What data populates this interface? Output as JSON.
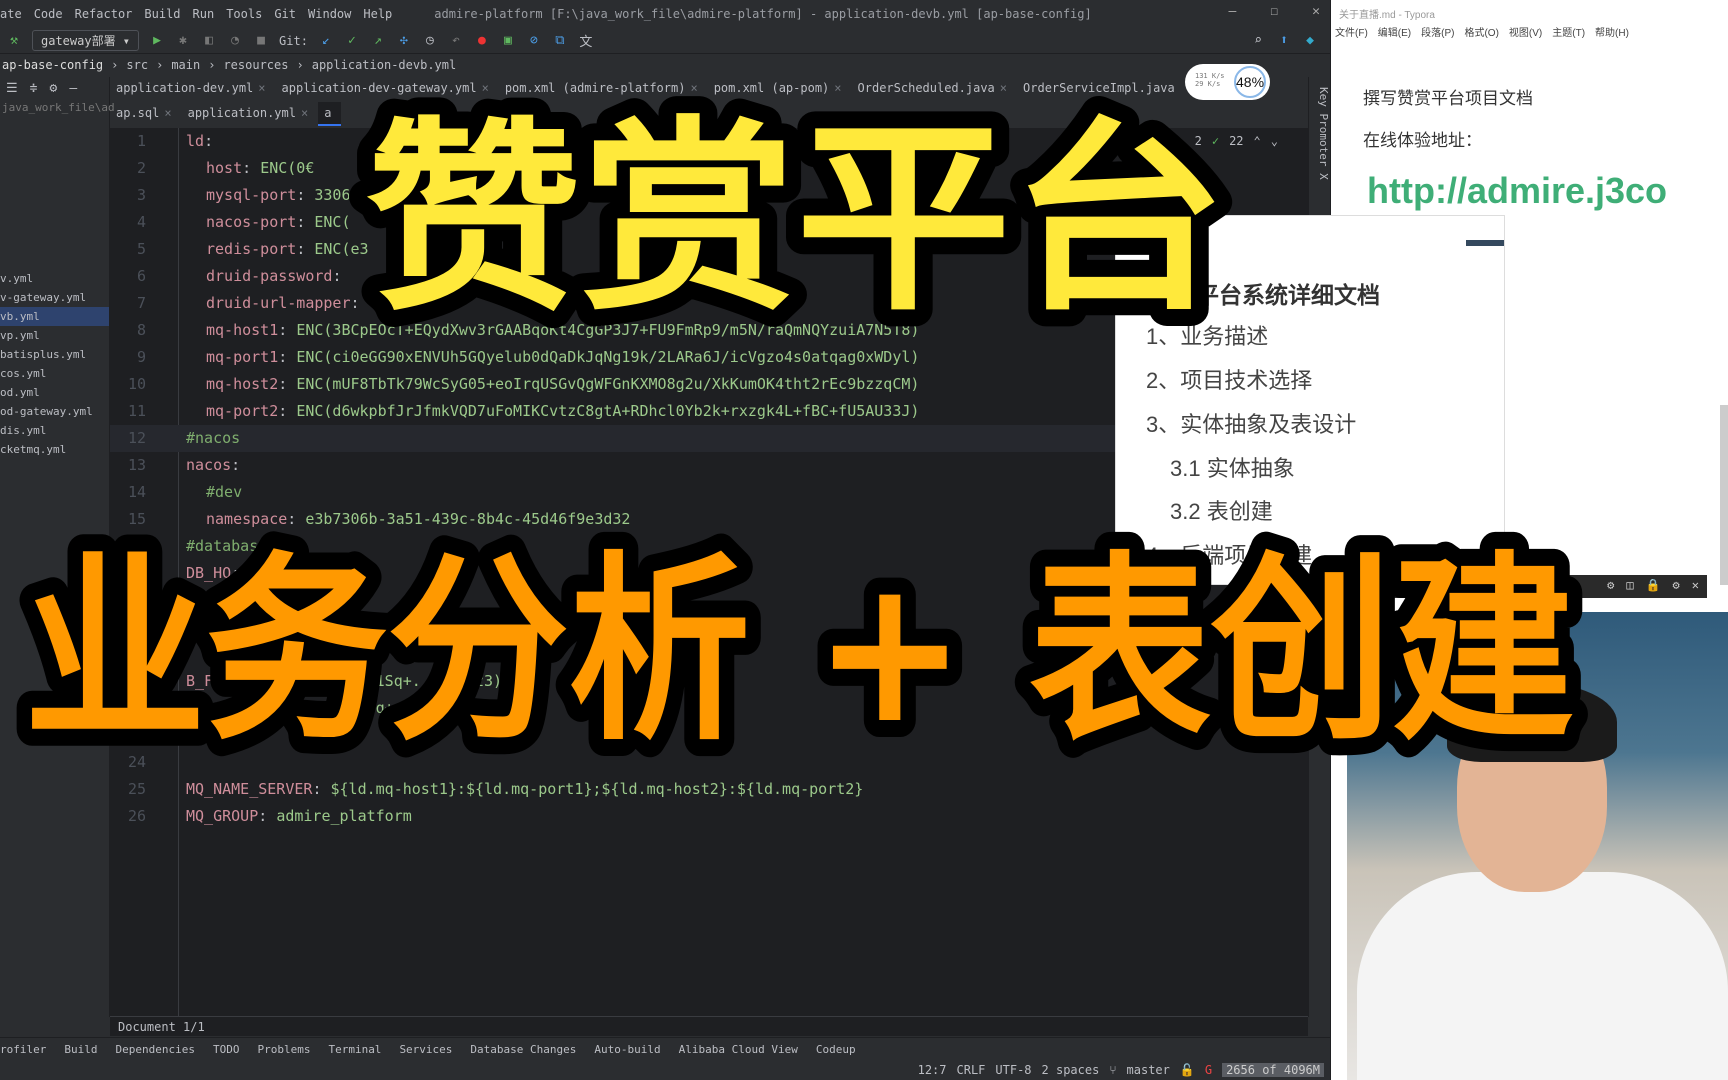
{
  "titlebar": {
    "menu": [
      "ate",
      "Code",
      "Refactor",
      "Build",
      "Run",
      "Tools",
      "Git",
      "Window",
      "Help"
    ],
    "title": "admire-platform [F:\\java_work_file\\admire-platform] - application-devb.yml [ap-base-config]"
  },
  "toolbar": {
    "run_config": "gateway部署",
    "git_label": "Git:"
  },
  "breadcrumb": [
    "ap-base-config",
    "src",
    "main",
    "resources",
    "application-devb.yml"
  ],
  "tabs_row1": [
    "application-dev.yml",
    "application-dev-gateway.yml",
    "pom.xml (admire-platform)",
    "pom.xml (ap-pom)",
    "OrderScheduled.java",
    "OrderServiceImpl.java"
  ],
  "tabs_row2": [
    "ap.sql",
    "application.yml",
    "a"
  ],
  "sidebar": {
    "path": "java_work_file\\ad",
    "files": [
      "v.yml",
      "v-gateway.yml",
      "vb.yml",
      "vp.yml",
      "batisplus.yml",
      "cos.yml",
      "od.yml",
      "od-gateway.yml",
      "dis.yml",
      "cketmq.yml"
    ]
  },
  "net_widget": {
    "up": "131 K/s",
    "down": "29 K/s",
    "percent": "48%"
  },
  "inspections": {
    "warnings": "2",
    "ok": "22"
  },
  "code_lines": [
    {
      "n": "1",
      "k": "ld",
      "v": ""
    },
    {
      "n": "2",
      "k": "host",
      "v": "ENC(0€"
    },
    {
      "n": "3",
      "k": "mysql-port",
      "v": "3306"
    },
    {
      "n": "4",
      "k": "nacos-port",
      "v": "ENC("
    },
    {
      "n": "5",
      "k": "redis-port",
      "v": "ENC(e3"
    },
    {
      "n": "6",
      "k": "druid-password",
      "v": ""
    },
    {
      "n": "7",
      "k": "druid-url-mapper",
      "v": ""
    },
    {
      "n": "8",
      "k": "mq-host1",
      "v": "ENC(3BCpEOcT+EQydXwv3rGAABqoKt4CgGP3J7+FU9FmRp9/m5N/raQmNQYzuiA7N5T8)"
    },
    {
      "n": "9",
      "k": "mq-port1",
      "v": "ENC(ci0eGG90xENVUh5GQyelub0dQaDkJqNg19k/2LARa6J/icVgzo4s0atqag0xWDyl)"
    },
    {
      "n": "10",
      "k": "mq-host2",
      "v": "ENC(mUF8TbTk79WcSyG05+eoIrqUSGvQgWFGnKXMO8g2u/XkKumOK4tht2rEc9bzzqCM)"
    },
    {
      "n": "11",
      "k": "mq-port2",
      "v": "ENC(d6wkpbfJrJfmkVQD7uFoMIKCvtzC8gtA+RDhcl0Yb2k+rxzgk4L+fBC+fU5AU33J)"
    },
    {
      "n": "12",
      "k": "",
      "v": "#nacos"
    },
    {
      "n": "13",
      "k": "nacos",
      "v": ""
    },
    {
      "n": "14",
      "k": "",
      "v": "#dev"
    },
    {
      "n": "15",
      "k": "namespace",
      "v": "e3b7306b-3a51-439c-8b4c-45d46f9e3d32"
    },
    {
      "n": "16",
      "k": "",
      "v": "#databas"
    },
    {
      "n": "17",
      "k": "DB_HO",
      "v": "${ld."
    },
    {
      "n": "",
      "k": "",
      "v": ""
    },
    {
      "n": "",
      "k": "",
      "v": ""
    },
    {
      "n": "",
      "k": "",
      "v": ""
    },
    {
      "n": "",
      "k": "B_F",
      "v": "eo1i...t+TQtbLZr1Sq+...mLosz3)"
    },
    {
      "n": "",
      "k": "",
      "v": "...t...vOAt+TQtbLZr1Sq+...LHmmLosz3)"
    },
    {
      "n": "",
      "k": "",
      "v": ""
    },
    {
      "n": "24",
      "k": "",
      "v": ""
    },
    {
      "n": "25",
      "k": "MQ_NAME_SERVER",
      "v": "${ld.mq-host1}:${ld.mq-port1};${ld.mq-host2}:${ld.mq-port2}"
    },
    {
      "n": "26",
      "k": "MQ_GROUP",
      "v": "admire_platform"
    }
  ],
  "docbar": "Document 1/1",
  "toolwindows": [
    "rofiler",
    "Build",
    "Dependencies",
    "TODO",
    "Problems",
    "Terminal",
    "Services",
    "Database Changes",
    "Auto-build",
    "Alibaba Cloud View",
    "Codeup"
  ],
  "status": {
    "pos": "12:7",
    "eol": "CRLF",
    "enc": "UTF-8",
    "indent": "2 spaces",
    "branch": "master",
    "memory": "2656 of 4096M"
  },
  "keypromoter": "Key Promoter X",
  "typora": {
    "title": "关于直播.md - Typora",
    "menu": [
      "文件(F)",
      "编辑(E)",
      "段落(P)",
      "格式(O)",
      "视图(V)",
      "主题(T)",
      "帮助(H)"
    ],
    "p1": "撰写赞赏平台项目文档",
    "p2": "在线体验地址：",
    "link": "http://admire.j3co"
  },
  "popup": {
    "heading": "平台系统详细文档",
    "toc": [
      "1、业务描述",
      "2、项目技术选择",
      "3、实体抽象及表设计",
      "3.1 实体抽象",
      "3.2 表创建",
      "4、后端项目搭建"
    ]
  },
  "overlay": {
    "title": "赞赏平台",
    "subtitle": "业务分析 + 表创建",
    "title_color": "#ffe93b",
    "subtitle_color": "#ff9900"
  }
}
